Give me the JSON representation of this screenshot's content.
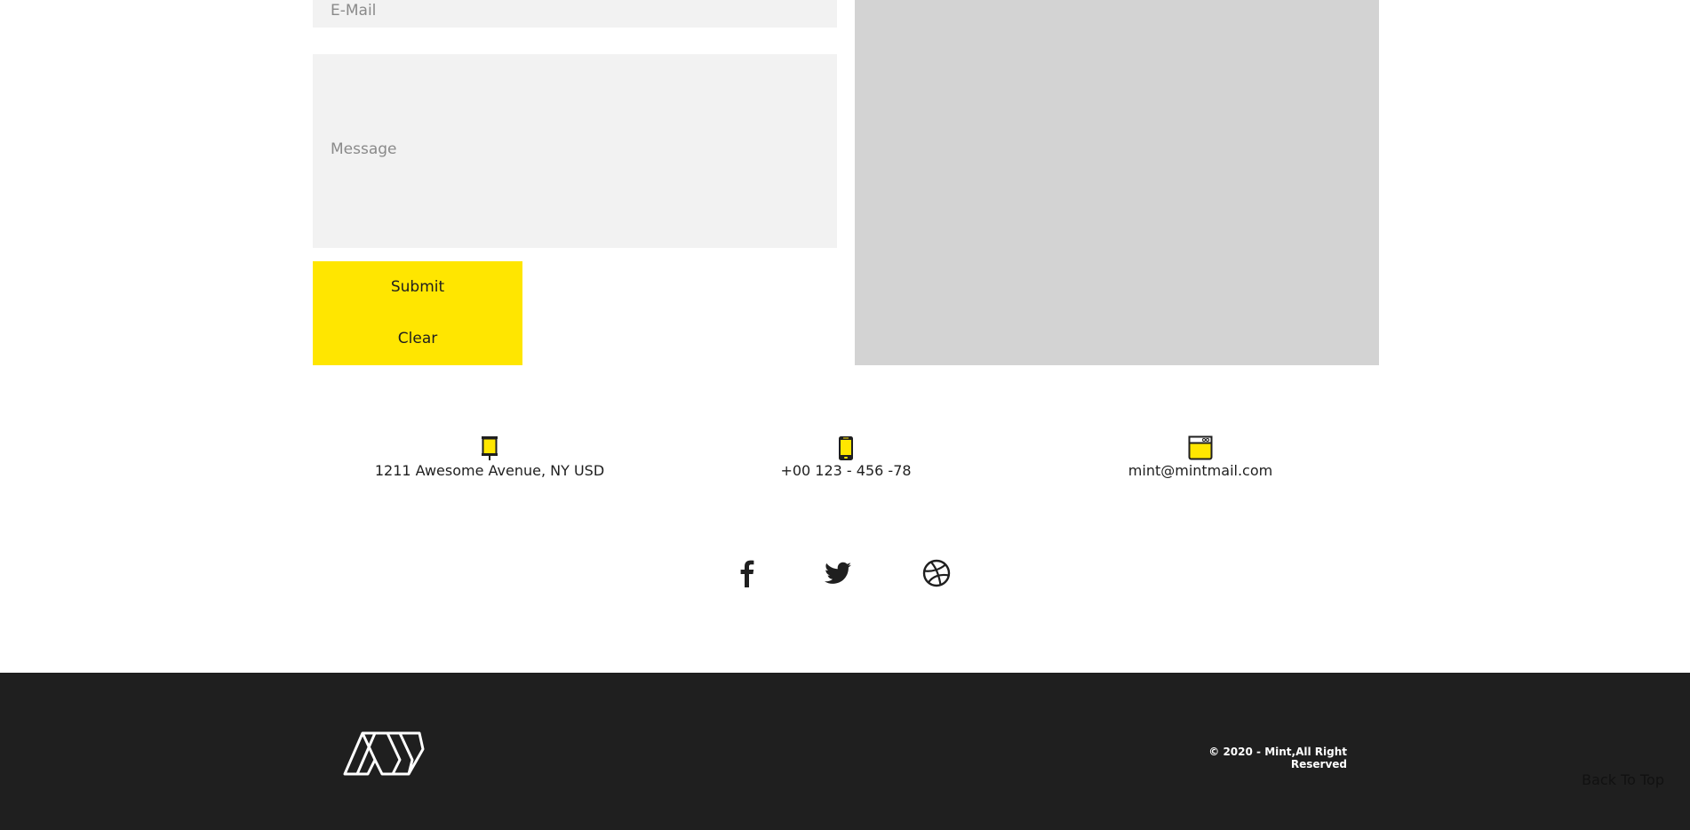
{
  "form": {
    "email_placeholder": "E-Mail",
    "message_placeholder": "Message",
    "submit_label": "Submit",
    "clear_label": "Clear"
  },
  "contact": {
    "address": "1211 Awesome Avenue, NY USD",
    "phone": "+00 123 - 456 -78",
    "email": "mint@mintmail.com",
    "address_icon": "signpost-icon",
    "phone_icon": "phone-icon",
    "email_icon": "browser-window-icon"
  },
  "social": {
    "icons": [
      "facebook-icon",
      "twitter-icon",
      "dribbble-icon"
    ]
  },
  "footer": {
    "logo": "Mint",
    "copyright": "© 2020 - Mint,All Right Reserved",
    "back_to_top": "Back To Top"
  },
  "colors": {
    "accent": "#ffe600",
    "input_bg": "#f2f2f2",
    "map_bg": "#d3d3d3",
    "footer_bg": "#1f1f1f",
    "text": "#1f1f1f"
  }
}
